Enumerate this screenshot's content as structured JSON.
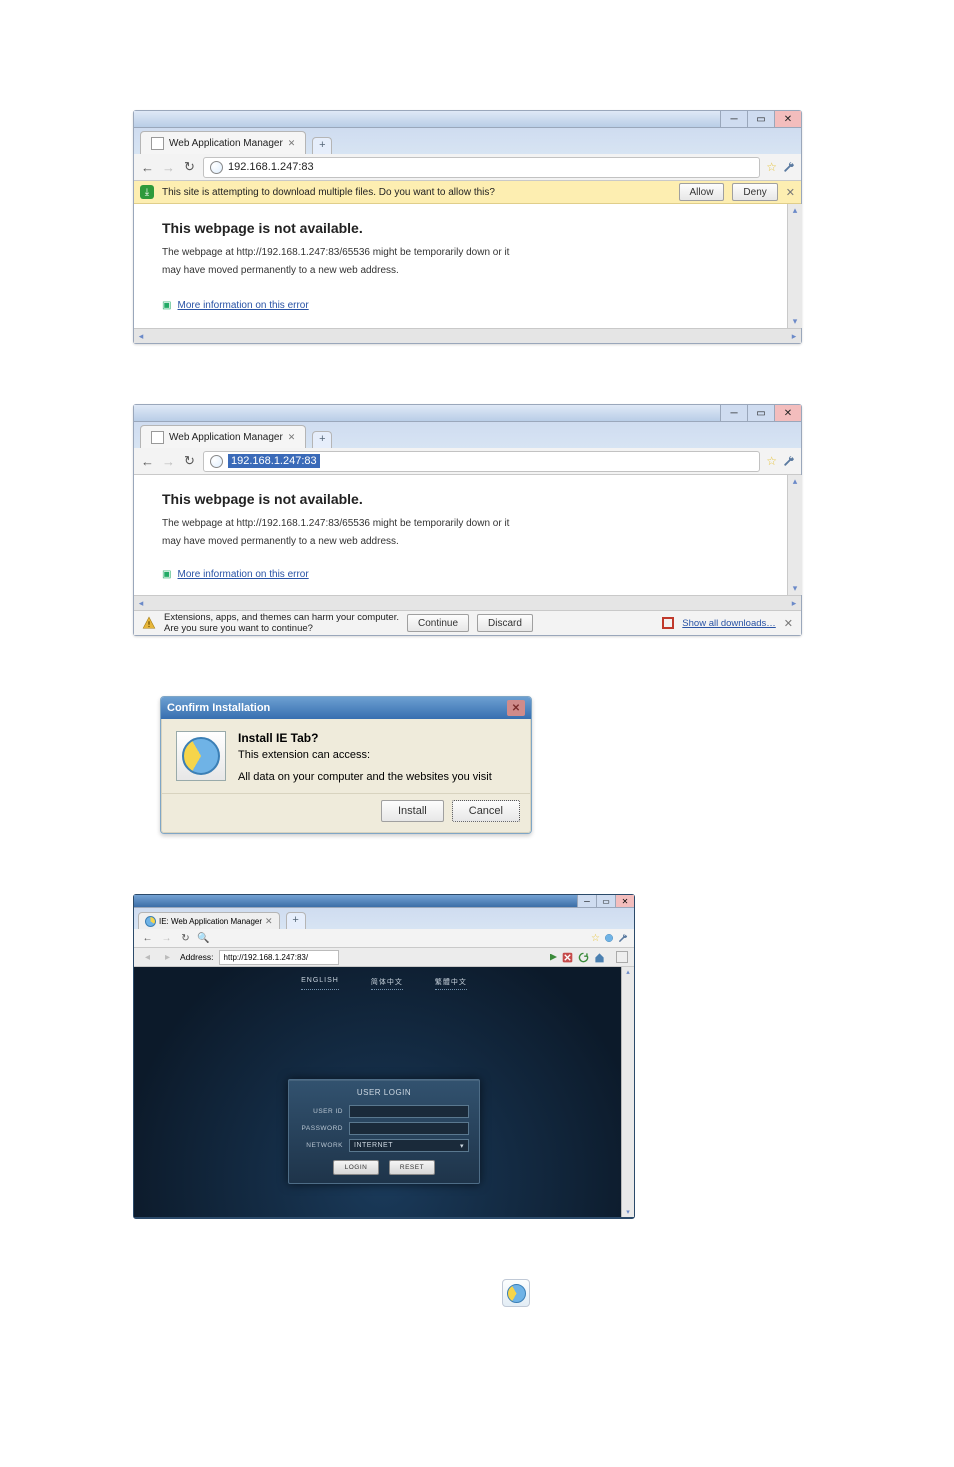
{
  "shot1": {
    "tab_title": "Web Application Manager",
    "address": "192.168.1.247:83",
    "alert_text": "This site is attempting to download multiple files. Do you want to allow this?",
    "btn_allow": "Allow",
    "btn_deny": "Deny",
    "heading": "This webpage is not available.",
    "msg1": "The webpage at http://192.168.1.247:83/65536 might be temporarily down or it",
    "msg2": "may have moved permanently to a new web address.",
    "more": "More information on this error"
  },
  "shot2": {
    "tab_title": "Web Application Manager",
    "address_sel": "192.168.1.247:83",
    "heading": "This webpage is not available.",
    "msg1": "The webpage at http://192.168.1.247:83/65536 might be temporarily down or it",
    "msg2": "may have moved permanently to a new web address.",
    "more": "More information on this error",
    "dl_warn1": "Extensions, apps, and themes can harm your computer.",
    "dl_warn2": "Are you sure you want to continue?",
    "btn_continue": "Continue",
    "btn_discard": "Discard",
    "show_all": "Show all downloads…"
  },
  "dialog": {
    "title": "Confirm Installation",
    "heading": "Install IE Tab?",
    "sub": "This extension can access:",
    "desc": "All data on your computer and the websites you visit",
    "btn_install": "Install",
    "btn_cancel": "Cancel"
  },
  "shot3": {
    "tab_title": "IE: Web Application Manager",
    "address_label": "Address:",
    "address": "http://192.168.1.247:83/",
    "lang_en": "ENGLISH",
    "lang_cn1": "简体中文",
    "lang_cn2": "繁體中文",
    "login_title": "USER LOGIN",
    "lbl_user": "USER ID",
    "lbl_pass": "PASSWORD",
    "lbl_net": "NETWORK",
    "net_value": "INTERNET",
    "btn_login": "LOGIN",
    "btn_reset": "RESET"
  }
}
